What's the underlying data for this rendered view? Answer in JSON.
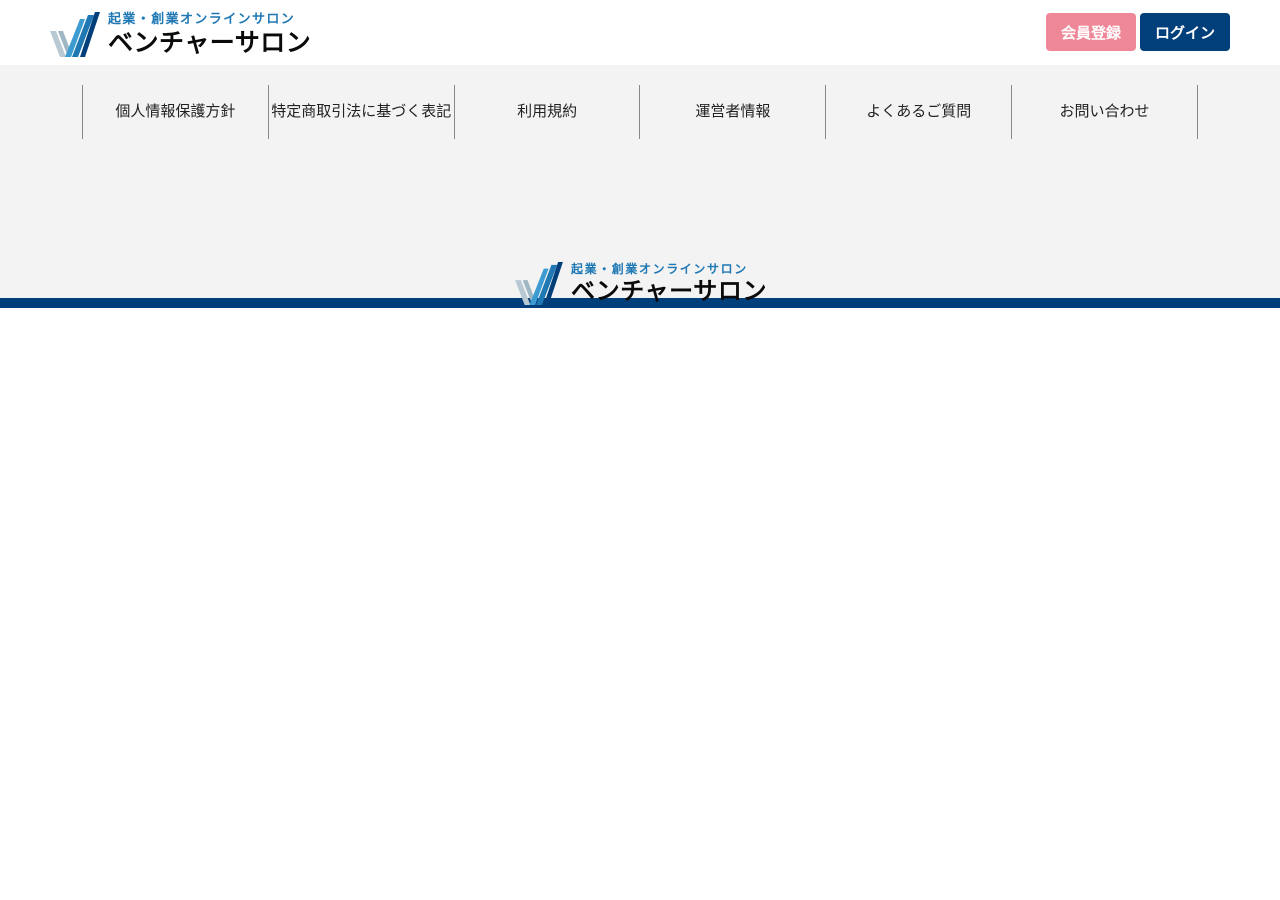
{
  "header": {
    "logo": {
      "tagline": "起業・創業オンラインサロン",
      "name": "ベンチャーサロン",
      "icon": "venture-salon-logo-icon"
    },
    "buttons": {
      "register_label": "会員登録",
      "login_label": "ログイン"
    }
  },
  "footer": {
    "nav": [
      {
        "label": "個人情報保護方針"
      },
      {
        "label": "特定商取引法に基づく表記"
      },
      {
        "label": "利用規約"
      },
      {
        "label": "運営者情報"
      },
      {
        "label": "よくあるご質問"
      },
      {
        "label": "お問い合わせ"
      }
    ],
    "logo": {
      "tagline": "起業・創業オンラインサロン",
      "name": "ベンチャーサロン",
      "icon": "venture-salon-logo-icon"
    }
  },
  "colors": {
    "brand_navy": "#003f7a",
    "brand_blue": "#1f78b4",
    "register_pink": "#ee8797",
    "footer_bg": "#f3f3f3"
  }
}
